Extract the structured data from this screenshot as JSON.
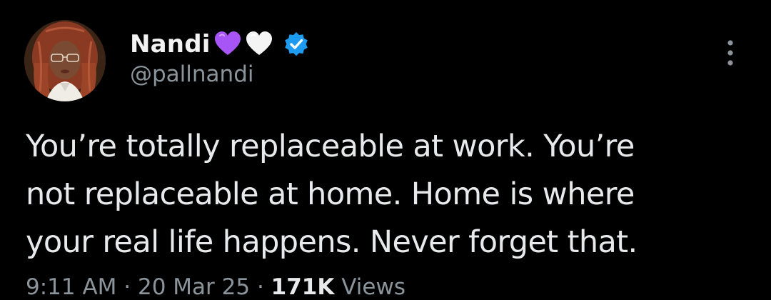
{
  "tweet": {
    "author": {
      "display_name": "Nandi",
      "handle": "@pallnandi",
      "name_emojis": [
        "purple-heart-emoji",
        "white-heart-emoji"
      ],
      "verified_icon": "verified-badge-icon",
      "avatar_icon": "profile-avatar"
    },
    "text_lines": [
      "You’re totally replaceable at work. You’re",
      "not replaceable at home. Home is where",
      "your real life happens. Never forget that."
    ],
    "meta": {
      "time": "9:11 AM",
      "separator": "·",
      "date": "20 Mar 25",
      "views_count": "171K",
      "views_label": "Views"
    },
    "more_icon": "more-options-icon"
  },
  "colors": {
    "background": "#000000",
    "text_primary": "#e7e9ea",
    "text_secondary": "#8b949b",
    "verified_blue": "#1d9bf0",
    "purple_heart": "#a855f7"
  }
}
